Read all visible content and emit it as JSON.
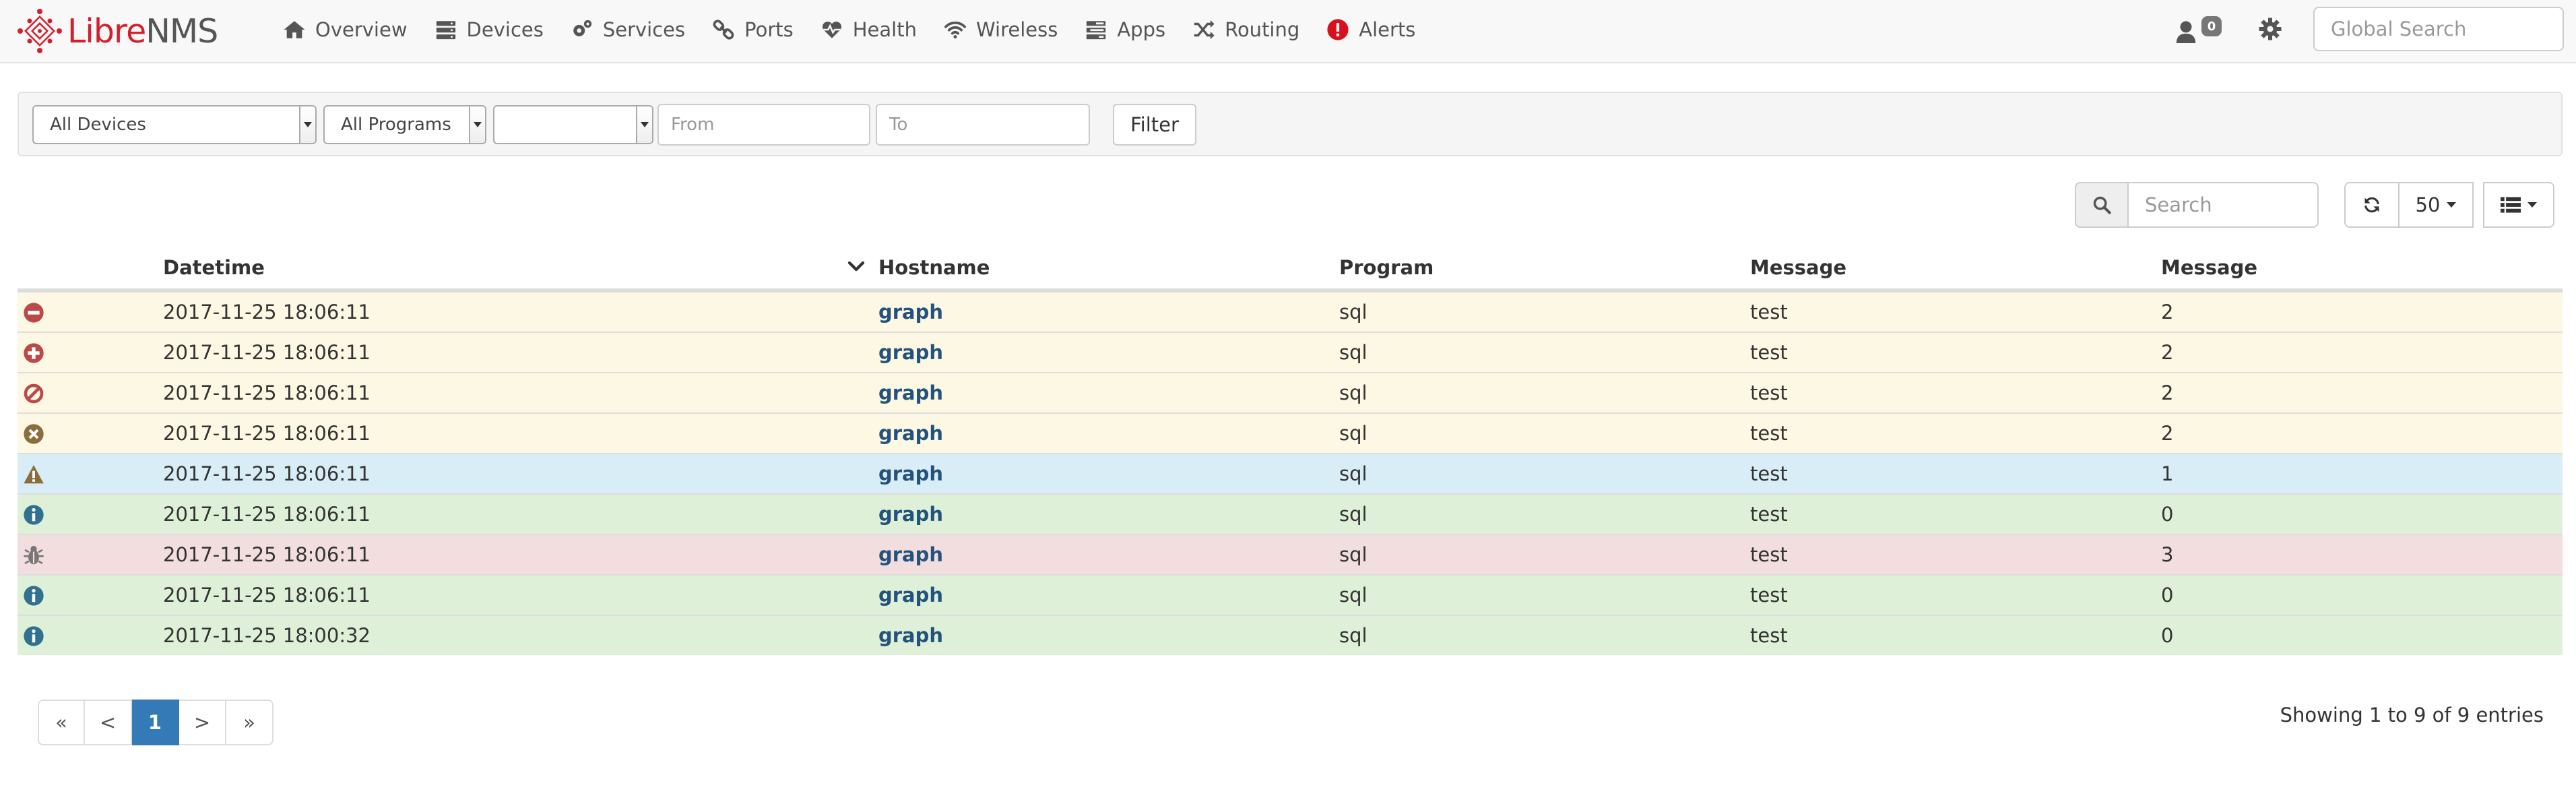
{
  "brand": {
    "part1": "Libre",
    "part2": "NMS"
  },
  "nav": {
    "items": [
      {
        "label": "Overview",
        "icon": "home-icon"
      },
      {
        "label": "Devices",
        "icon": "server-icon"
      },
      {
        "label": "Services",
        "icon": "cogs-icon"
      },
      {
        "label": "Ports",
        "icon": "link-icon"
      },
      {
        "label": "Health",
        "icon": "heartbeat-icon"
      },
      {
        "label": "Wireless",
        "icon": "wifi-icon"
      },
      {
        "label": "Apps",
        "icon": "tasks-icon"
      },
      {
        "label": "Routing",
        "icon": "random-icon"
      },
      {
        "label": "Alerts",
        "icon": "exclamation-circle-icon"
      }
    ],
    "notification_count": "0",
    "global_search_placeholder": "Global Search"
  },
  "filters": {
    "device_select": "All Devices",
    "program_select": "All Programs",
    "priority_select": "",
    "from_placeholder": "From",
    "to_placeholder": "To",
    "filter_label": "Filter"
  },
  "toolbar": {
    "search_placeholder": "Search",
    "page_size": "50"
  },
  "table": {
    "columns": [
      "Datetime",
      "Hostname",
      "Program",
      "Message",
      "Message"
    ],
    "rows": [
      {
        "status": "warning",
        "icon": "minus-circle-icon",
        "icon_color": "#b94a48",
        "datetime": "2017-11-25 18:06:11",
        "hostname": "graph",
        "program": "sql",
        "message": "test",
        "priority": "2"
      },
      {
        "status": "warning",
        "icon": "plus-circle-icon",
        "icon_color": "#b94a48",
        "datetime": "2017-11-25 18:06:11",
        "hostname": "graph",
        "program": "sql",
        "message": "test",
        "priority": "2"
      },
      {
        "status": "warning",
        "icon": "ban-icon",
        "icon_color": "#b94a48",
        "datetime": "2017-11-25 18:06:11",
        "hostname": "graph",
        "program": "sql",
        "message": "test",
        "priority": "2"
      },
      {
        "status": "warning",
        "icon": "times-circle-icon",
        "icon_color": "#8a6d3b",
        "datetime": "2017-11-25 18:06:11",
        "hostname": "graph",
        "program": "sql",
        "message": "test",
        "priority": "2"
      },
      {
        "status": "info",
        "icon": "warning-icon",
        "icon_color": "#8a6d3b",
        "datetime": "2017-11-25 18:06:11",
        "hostname": "graph",
        "program": "sql",
        "message": "test",
        "priority": "1"
      },
      {
        "status": "success",
        "icon": "info-circle-icon",
        "icon_color": "#31708f",
        "datetime": "2017-11-25 18:06:11",
        "hostname": "graph",
        "program": "sql",
        "message": "test",
        "priority": "0"
      },
      {
        "status": "danger",
        "icon": "bug-icon",
        "icon_color": "#777777",
        "datetime": "2017-11-25 18:06:11",
        "hostname": "graph",
        "program": "sql",
        "message": "test",
        "priority": "3"
      },
      {
        "status": "success",
        "icon": "info-circle-icon",
        "icon_color": "#31708f",
        "datetime": "2017-11-25 18:06:11",
        "hostname": "graph",
        "program": "sql",
        "message": "test",
        "priority": "0"
      },
      {
        "status": "success",
        "icon": "info-circle-icon",
        "icon_color": "#31708f",
        "datetime": "2017-11-25 18:00:32",
        "hostname": "graph",
        "program": "sql",
        "message": "test",
        "priority": "0"
      }
    ]
  },
  "pagination": {
    "first": "«",
    "prev": "<",
    "current": "1",
    "next": ">",
    "last": "»",
    "info": "Showing 1 to 9 of 9 entries"
  },
  "colors": {
    "brand_red": "#d3202d",
    "link_blue": "#23527c",
    "active_page": "#337ab7",
    "row_warning": "#fcf8e3",
    "row_info": "#d9edf7",
    "row_success": "#dff0d8",
    "row_danger": "#f2dede"
  }
}
